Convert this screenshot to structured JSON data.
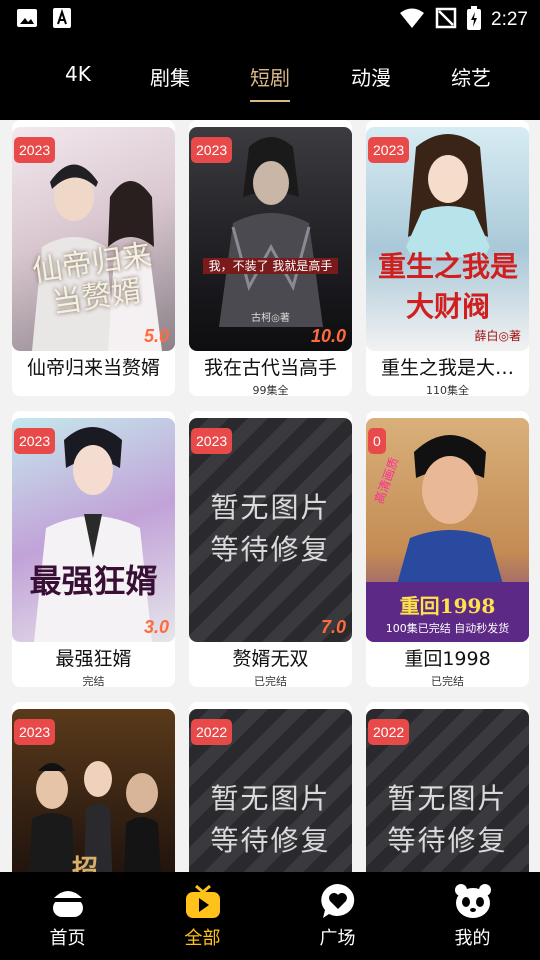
{
  "status_bar": {
    "time": "2:27"
  },
  "tabs": [
    {
      "label": "4K"
    },
    {
      "label": "剧集"
    },
    {
      "label": "短剧"
    },
    {
      "label": "动漫"
    },
    {
      "label": "综艺"
    }
  ],
  "active_tab": "短剧",
  "cards": [
    {
      "year": "2023",
      "title": "仙帝归来当赘婿",
      "subtitle": "",
      "rating": "5.0",
      "poster_text": "仙帝归来当赘婿"
    },
    {
      "year": "2023",
      "title": "我在古代当高手",
      "subtitle": "99集全",
      "rating": "10.0",
      "poster_text": "我，不装了 我就是高手",
      "poster_author": "古柯◎著"
    },
    {
      "year": "2023",
      "title": "重生之我是大…",
      "subtitle": "110集全",
      "rating": "",
      "poster_text": "重生之我是大财阀",
      "poster_author": "薛白◎著"
    },
    {
      "year": "2023",
      "title": "最强狂婿",
      "subtitle": "完结",
      "rating": "3.0",
      "poster_text": "最强狂婿"
    },
    {
      "year": "2023",
      "title": "赘婿无双",
      "subtitle": "已完结",
      "rating": "7.0",
      "placeholder": [
        "暂无图片",
        "等待修复"
      ]
    },
    {
      "year": "0",
      "title": "重回1998",
      "subtitle": "已完结",
      "rating": "",
      "poster_text": "重回1998",
      "poster_banner": "100集已完结 自动秒发货",
      "poster_tag": "高清画质"
    },
    {
      "year": "2023",
      "title": "",
      "subtitle": "",
      "rating": "",
      "poster_text": "招"
    },
    {
      "year": "2022",
      "title": "",
      "subtitle": "",
      "rating": "",
      "placeholder": [
        "暂无图片",
        "等待修复"
      ]
    },
    {
      "year": "2022",
      "title": "",
      "subtitle": "",
      "rating": "",
      "placeholder": [
        "暂无图片",
        "等待修复"
      ]
    }
  ],
  "bottom_nav": [
    {
      "label": "首页",
      "icon": "home-icon"
    },
    {
      "label": "全部",
      "icon": "tv-icon",
      "active": true
    },
    {
      "label": "广场",
      "icon": "heart-bubble-icon"
    },
    {
      "label": "我的",
      "icon": "panda-icon"
    }
  ],
  "colors": {
    "accent_tab": "#d9b98a",
    "accent_nav": "#ffc21a",
    "year_badge": "#e84a4a"
  }
}
